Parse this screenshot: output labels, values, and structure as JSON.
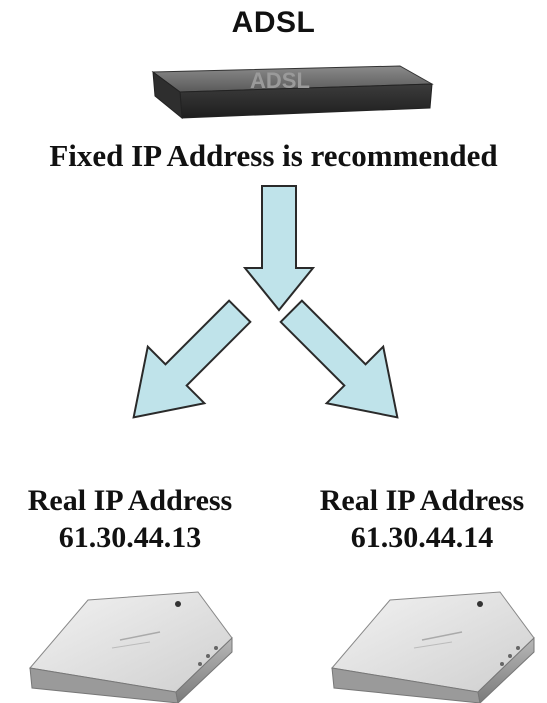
{
  "modem": {
    "label": "ADSL",
    "device_text": "ADSL"
  },
  "note": "Fixed IP Address is recommended",
  "devices": [
    {
      "label": "Real IP Address",
      "ip": "61.30.44.13"
    },
    {
      "label": "Real IP Address",
      "ip": "61.30.44.14"
    }
  ],
  "colors": {
    "arrow_fill": "#bfe3ea",
    "arrow_stroke": "#2a2a2a",
    "modem_body": "#4a4a4a"
  }
}
